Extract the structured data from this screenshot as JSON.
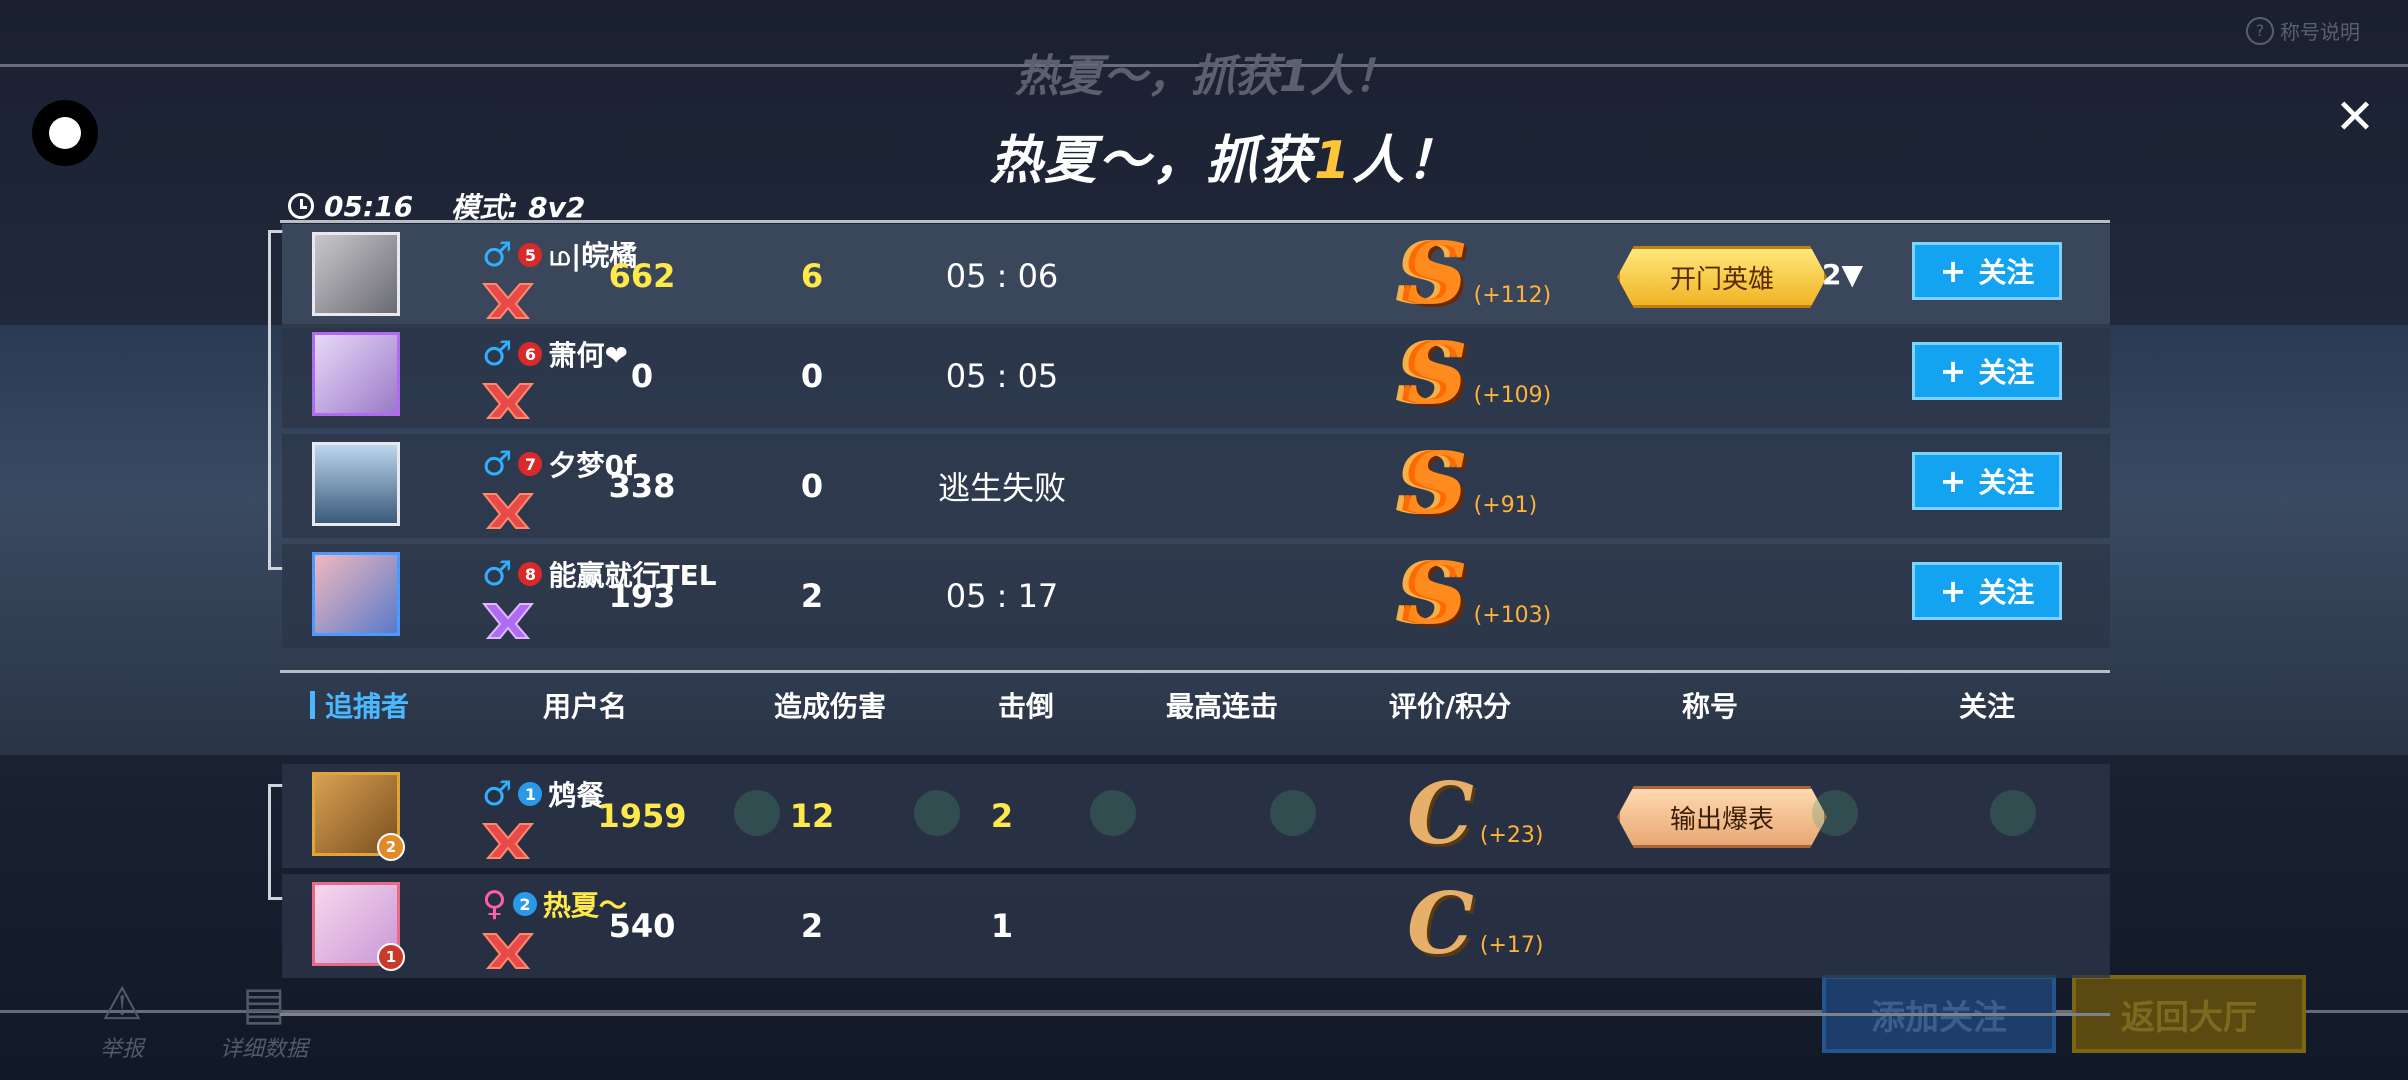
{
  "background": {
    "ghost_title": "热夏～，抓获1人！",
    "help_label": "称号说明",
    "add_follow": "添加关注",
    "back_lobby": "返回大厅",
    "report": "举报",
    "details": "详细数据"
  },
  "header": {
    "title_prefix": "热夏～，抓获",
    "title_count": "1",
    "title_suffix": "人！",
    "time": "05:16",
    "mode": "模式: 8v2"
  },
  "survivors": [
    {
      "gender": "♂",
      "level": "5",
      "name": "ம|皖橘",
      "damage": "662",
      "knockdowns": "6",
      "stat": "05 : 06",
      "grade": "S",
      "points": "(+112)",
      "title": "开门英雄",
      "title_count": "2▼",
      "follow": "关注",
      "highlight": true
    },
    {
      "gender": "♂",
      "level": "6",
      "name": "萧何❤",
      "damage": "0",
      "knockdowns": "0",
      "stat": "05 : 05",
      "grade": "S",
      "points": "(+109)",
      "title": "",
      "title_count": "",
      "follow": "关注",
      "highlight": false
    },
    {
      "gender": "♂",
      "level": "7",
      "name": "夕梦0f",
      "damage": "338",
      "knockdowns": "0",
      "stat": "逃生失败",
      "grade": "S",
      "points": "(+91)",
      "title": "",
      "title_count": "",
      "follow": "关注",
      "highlight": false
    },
    {
      "gender": "♂",
      "level": "8",
      "name": "能赢就行TEL",
      "damage": "193",
      "knockdowns": "2",
      "stat": "05 : 17",
      "grade": "S",
      "points": "(+103)",
      "title": "",
      "title_count": "",
      "follow": "关注",
      "highlight": false
    }
  ],
  "columns": {
    "team": "追捕者",
    "username": "用户名",
    "damage": "造成伤害",
    "knockdowns": "击倒",
    "combo": "最高连击",
    "grade": "评价/积分",
    "title": "称号",
    "follow": "关注"
  },
  "hunters": [
    {
      "gender": "♂",
      "level": "1",
      "name": "鸩餐",
      "damage": "1959",
      "knockdowns": "12",
      "stat": "2",
      "grade": "C",
      "points": "(+23)",
      "title": "输出爆表",
      "badge": "2",
      "highlight": true,
      "name_yellow": false
    },
    {
      "gender": "♀",
      "level": "2",
      "name": "热夏～",
      "damage": "540",
      "knockdowns": "2",
      "stat": "1",
      "grade": "C",
      "points": "(+17)",
      "title": "",
      "badge": "1",
      "highlight": false,
      "name_yellow": true
    }
  ],
  "colors": {
    "accent_blue": "#14a3f0",
    "yellow": "#ffe94a",
    "orange_grade": "#ff8a1e"
  }
}
